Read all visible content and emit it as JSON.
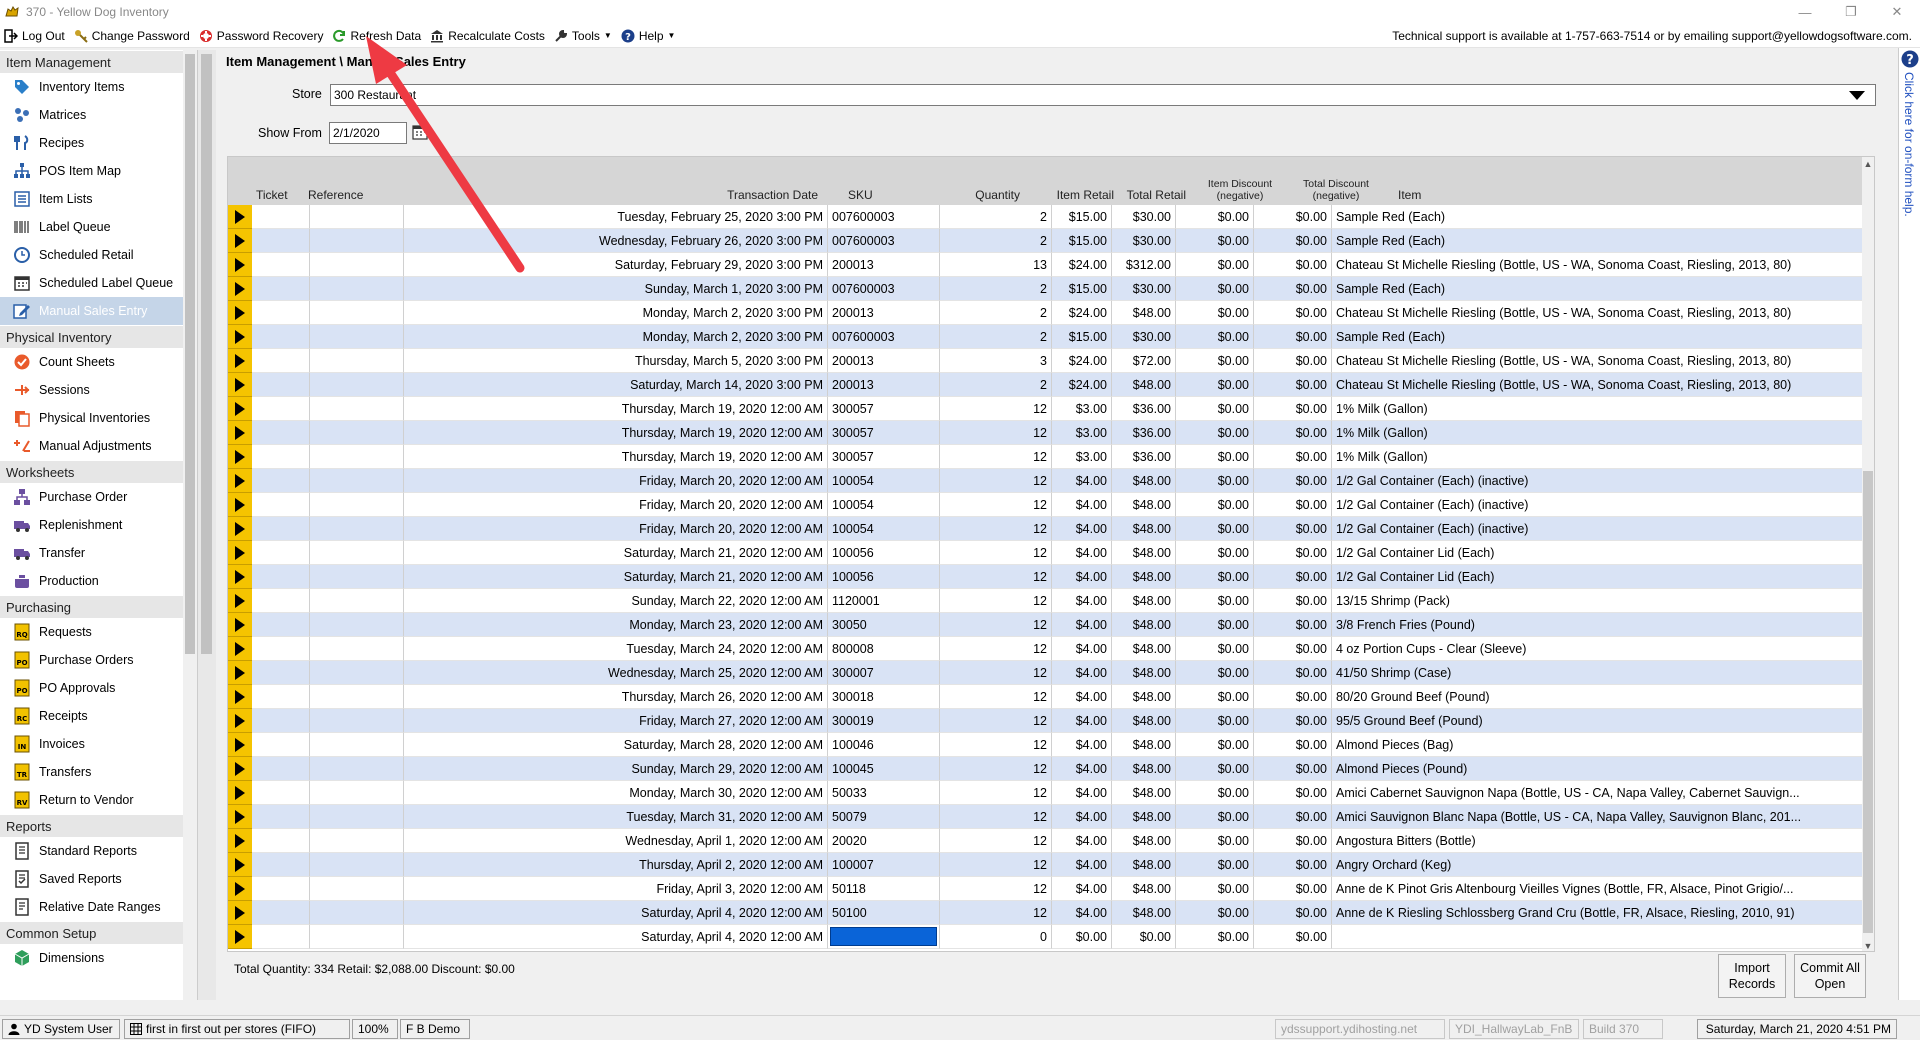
{
  "window": {
    "title": "370  - Yellow Dog Inventory"
  },
  "toolbar": {
    "items": [
      {
        "label": "Log Out",
        "icon": "log-out-icon"
      },
      {
        "label": "Change Password",
        "icon": "key-icon"
      },
      {
        "label": "Password Recovery",
        "icon": "lifebuoy-icon"
      },
      {
        "label": "Refresh Data",
        "icon": "refresh-icon"
      },
      {
        "label": "Recalculate Costs",
        "icon": "bank-icon"
      },
      {
        "label": "Tools",
        "icon": "wrench-icon"
      },
      {
        "label": "Help",
        "icon": "question-icon"
      }
    ],
    "support_text": "Technical support is available at 1-757-663-7514 or by emailing support@yellowdogsoftware.com."
  },
  "sidebar": {
    "sections": [
      {
        "title": "Item Management",
        "items": [
          "Inventory Items",
          "Matrices",
          "Recipes",
          "POS Item Map",
          "Item Lists",
          "Label Queue",
          "Scheduled Retail",
          "Scheduled Label Queue",
          "Manual Sales Entry"
        ]
      },
      {
        "title": "Physical Inventory",
        "items": [
          "Count Sheets",
          "Sessions",
          "Physical Inventories",
          "Manual Adjustments"
        ]
      },
      {
        "title": "Worksheets",
        "items": [
          "Purchase Order",
          "Replenishment",
          "Transfer",
          "Production"
        ]
      },
      {
        "title": "Purchasing",
        "items": [
          "Requests",
          "Purchase Orders",
          "PO Approvals",
          "Receipts",
          "Invoices",
          "Transfers",
          "Return to Vendor"
        ]
      },
      {
        "title": "Reports",
        "items": [
          "Standard Reports",
          "Saved Reports",
          "Relative Date Ranges"
        ]
      },
      {
        "title": "Common Setup",
        "items": [
          "Dimensions"
        ]
      }
    ],
    "active_item": "Manual Sales Entry"
  },
  "main": {
    "breadcrumb": "Item Management \\ Manual Sales Entry",
    "store_label": "Store",
    "store_value": "300 Restaurant",
    "show_from_label": "Show From",
    "show_from_value": "2/1/2020",
    "columns": {
      "ticket": "Ticket",
      "reference": "Reference",
      "date": "Transaction Date",
      "sku": "SKU",
      "qty": "Quantity",
      "item_retail": "Item Retail",
      "total_retail": "Total Retail",
      "item_discount": "Item Discount (negative)",
      "total_discount": "Total Discount (negative)",
      "item": "Item"
    },
    "rows": [
      {
        "date": "Tuesday, February 25, 2020 3:00 PM",
        "sku": "007600003",
        "qty": "2",
        "ir": "$15.00",
        "tr": "$30.00",
        "id": "$0.00",
        "td": "$0.00",
        "item": "Sample Red (Each)"
      },
      {
        "date": "Wednesday, February 26, 2020 3:00 PM",
        "sku": "007600003",
        "qty": "2",
        "ir": "$15.00",
        "tr": "$30.00",
        "id": "$0.00",
        "td": "$0.00",
        "item": "Sample Red (Each)"
      },
      {
        "date": "Saturday, February 29, 2020 3:00 PM",
        "sku": "200013",
        "qty": "13",
        "ir": "$24.00",
        "tr": "$312.00",
        "id": "$0.00",
        "td": "$0.00",
        "item": "Chateau St Michelle Riesling (Bottle, US - WA, Sonoma Coast, Riesling, 2013, 80)"
      },
      {
        "date": "Sunday, March 1, 2020 3:00 PM",
        "sku": "007600003",
        "qty": "2",
        "ir": "$15.00",
        "tr": "$30.00",
        "id": "$0.00",
        "td": "$0.00",
        "item": "Sample Red (Each)"
      },
      {
        "date": "Monday, March 2, 2020 3:00 PM",
        "sku": "200013",
        "qty": "2",
        "ir": "$24.00",
        "tr": "$48.00",
        "id": "$0.00",
        "td": "$0.00",
        "item": "Chateau St Michelle Riesling (Bottle, US - WA, Sonoma Coast, Riesling, 2013, 80)"
      },
      {
        "date": "Monday, March 2, 2020 3:00 PM",
        "sku": "007600003",
        "qty": "2",
        "ir": "$15.00",
        "tr": "$30.00",
        "id": "$0.00",
        "td": "$0.00",
        "item": "Sample Red (Each)"
      },
      {
        "date": "Thursday, March 5, 2020 3:00 PM",
        "sku": "200013",
        "qty": "3",
        "ir": "$24.00",
        "tr": "$72.00",
        "id": "$0.00",
        "td": "$0.00",
        "item": "Chateau St Michelle Riesling (Bottle, US - WA, Sonoma Coast, Riesling, 2013, 80)"
      },
      {
        "date": "Saturday, March 14, 2020 3:00 PM",
        "sku": "200013",
        "qty": "2",
        "ir": "$24.00",
        "tr": "$48.00",
        "id": "$0.00",
        "td": "$0.00",
        "item": "Chateau St Michelle Riesling (Bottle, US - WA, Sonoma Coast, Riesling, 2013, 80)"
      },
      {
        "date": "Thursday, March 19, 2020 12:00 AM",
        "sku": "300057",
        "qty": "12",
        "ir": "$3.00",
        "tr": "$36.00",
        "id": "$0.00",
        "td": "$0.00",
        "item": "1% Milk (Gallon)"
      },
      {
        "date": "Thursday, March 19, 2020 12:00 AM",
        "sku": "300057",
        "qty": "12",
        "ir": "$3.00",
        "tr": "$36.00",
        "id": "$0.00",
        "td": "$0.00",
        "item": "1% Milk (Gallon)"
      },
      {
        "date": "Thursday, March 19, 2020 12:00 AM",
        "sku": "300057",
        "qty": "12",
        "ir": "$3.00",
        "tr": "$36.00",
        "id": "$0.00",
        "td": "$0.00",
        "item": "1% Milk (Gallon)"
      },
      {
        "date": "Friday, March 20, 2020 12:00 AM",
        "sku": "100054",
        "qty": "12",
        "ir": "$4.00",
        "tr": "$48.00",
        "id": "$0.00",
        "td": "$0.00",
        "item": "1/2 Gal Container (Each) (inactive)"
      },
      {
        "date": "Friday, March 20, 2020 12:00 AM",
        "sku": "100054",
        "qty": "12",
        "ir": "$4.00",
        "tr": "$48.00",
        "id": "$0.00",
        "td": "$0.00",
        "item": "1/2 Gal Container (Each) (inactive)"
      },
      {
        "date": "Friday, March 20, 2020 12:00 AM",
        "sku": "100054",
        "qty": "12",
        "ir": "$4.00",
        "tr": "$48.00",
        "id": "$0.00",
        "td": "$0.00",
        "item": "1/2 Gal Container (Each) (inactive)"
      },
      {
        "date": "Saturday, March 21, 2020 12:00 AM",
        "sku": "100056",
        "qty": "12",
        "ir": "$4.00",
        "tr": "$48.00",
        "id": "$0.00",
        "td": "$0.00",
        "item": "1/2 Gal Container Lid (Each)"
      },
      {
        "date": "Saturday, March 21, 2020 12:00 AM",
        "sku": "100056",
        "qty": "12",
        "ir": "$4.00",
        "tr": "$48.00",
        "id": "$0.00",
        "td": "$0.00",
        "item": "1/2 Gal Container Lid (Each)"
      },
      {
        "date": "Sunday, March 22, 2020 12:00 AM",
        "sku": "1120001",
        "qty": "12",
        "ir": "$4.00",
        "tr": "$48.00",
        "id": "$0.00",
        "td": "$0.00",
        "item": "13/15 Shrimp (Pack)"
      },
      {
        "date": "Monday, March 23, 2020 12:00 AM",
        "sku": "30050",
        "qty": "12",
        "ir": "$4.00",
        "tr": "$48.00",
        "id": "$0.00",
        "td": "$0.00",
        "item": "3/8 French Fries (Pound)"
      },
      {
        "date": "Tuesday, March 24, 2020 12:00 AM",
        "sku": "800008",
        "qty": "12",
        "ir": "$4.00",
        "tr": "$48.00",
        "id": "$0.00",
        "td": "$0.00",
        "item": "4 oz Portion Cups - Clear (Sleeve)"
      },
      {
        "date": "Wednesday, March 25, 2020 12:00 AM",
        "sku": "300007",
        "qty": "12",
        "ir": "$4.00",
        "tr": "$48.00",
        "id": "$0.00",
        "td": "$0.00",
        "item": "41/50 Shrimp (Case)"
      },
      {
        "date": "Thursday, March 26, 2020 12:00 AM",
        "sku": "300018",
        "qty": "12",
        "ir": "$4.00",
        "tr": "$48.00",
        "id": "$0.00",
        "td": "$0.00",
        "item": "80/20 Ground Beef (Pound)"
      },
      {
        "date": "Friday, March 27, 2020 12:00 AM",
        "sku": "300019",
        "qty": "12",
        "ir": "$4.00",
        "tr": "$48.00",
        "id": "$0.00",
        "td": "$0.00",
        "item": "95/5 Ground Beef (Pound)"
      },
      {
        "date": "Saturday, March 28, 2020 12:00 AM",
        "sku": "100046",
        "qty": "12",
        "ir": "$4.00",
        "tr": "$48.00",
        "id": "$0.00",
        "td": "$0.00",
        "item": "Almond Pieces (Bag)"
      },
      {
        "date": "Sunday, March 29, 2020 12:00 AM",
        "sku": "100045",
        "qty": "12",
        "ir": "$4.00",
        "tr": "$48.00",
        "id": "$0.00",
        "td": "$0.00",
        "item": "Almond Pieces (Pound)"
      },
      {
        "date": "Monday, March 30, 2020 12:00 AM",
        "sku": "50033",
        "qty": "12",
        "ir": "$4.00",
        "tr": "$48.00",
        "id": "$0.00",
        "td": "$0.00",
        "item": "Amici Cabernet Sauvignon Napa (Bottle, US - CA, Napa Valley, Cabernet Sauvign..."
      },
      {
        "date": "Tuesday, March 31, 2020 12:00 AM",
        "sku": "50079",
        "qty": "12",
        "ir": "$4.00",
        "tr": "$48.00",
        "id": "$0.00",
        "td": "$0.00",
        "item": "Amici Sauvignon Blanc Napa (Bottle, US - CA, Napa Valley, Sauvignon Blanc, 201..."
      },
      {
        "date": "Wednesday, April 1, 2020 12:00 AM",
        "sku": "20020",
        "qty": "12",
        "ir": "$4.00",
        "tr": "$48.00",
        "id": "$0.00",
        "td": "$0.00",
        "item": "Angostura Bitters (Bottle)"
      },
      {
        "date": "Thursday, April 2, 2020 12:00 AM",
        "sku": "100007",
        "qty": "12",
        "ir": "$4.00",
        "tr": "$48.00",
        "id": "$0.00",
        "td": "$0.00",
        "item": "Angry Orchard (Keg)"
      },
      {
        "date": "Friday, April 3, 2020 12:00 AM",
        "sku": "50118",
        "qty": "12",
        "ir": "$4.00",
        "tr": "$48.00",
        "id": "$0.00",
        "td": "$0.00",
        "item": "Anne de K Pinot Gris Altenbourg Vieilles Vignes (Bottle, FR, Alsace, Pinot Grigio/..."
      },
      {
        "date": "Saturday, April 4, 2020 12:00 AM",
        "sku": "50100",
        "qty": "12",
        "ir": "$4.00",
        "tr": "$48.00",
        "id": "$0.00",
        "td": "$0.00",
        "item": "Anne de K Riesling Schlossberg Grand Cru (Bottle, FR, Alsace, Riesling, 2010, 91)"
      },
      {
        "date": "Saturday, April 4, 2020 12:00 AM",
        "sku": "",
        "qty": "0",
        "ir": "$0.00",
        "tr": "$0.00",
        "id": "$0.00",
        "td": "$0.00",
        "item": "",
        "editing": true
      }
    ],
    "totals": "Total Quantity: 334 Retail: $2,088.00 Discount: $0.00",
    "import_button": "Import Records",
    "commit_button": "Commit All Open"
  },
  "help_strip": {
    "text": "Click here for on-form help."
  },
  "statusbar": {
    "user": "YD System User",
    "costing": "first in first out per stores (FIFO)",
    "zoom": "100%",
    "database": "F B Demo",
    "server": "ydssupport.ydihosting.net",
    "site": "YDI_HallwayLab_FnB",
    "build": "Build 370",
    "datetime": "Saturday, March 21, 2020 4:51 PM"
  },
  "colors": {
    "row_alt": "#d9e3f5",
    "row_marker": "#f5c400",
    "annotation_arrow": "#ee3a43",
    "active_nav": "#c5d5e8"
  }
}
